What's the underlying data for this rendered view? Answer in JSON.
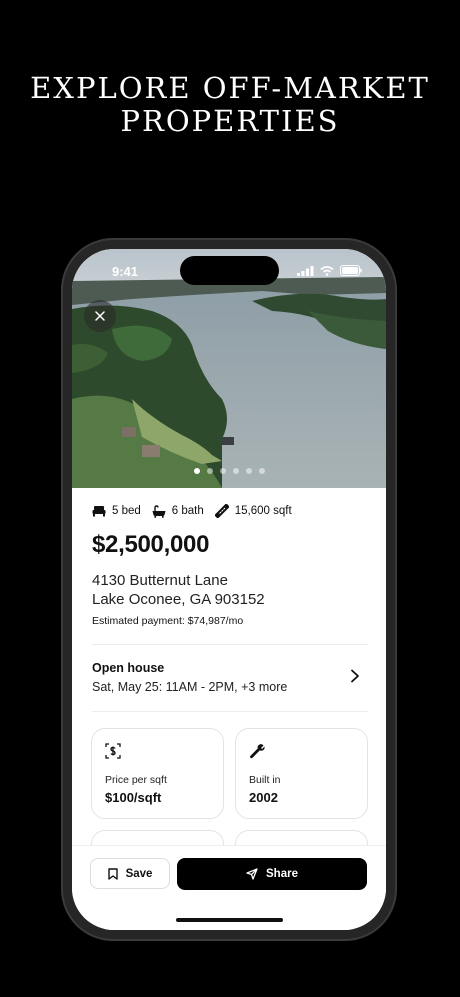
{
  "promo": {
    "headline_line1": "EXPLORE OFF-MARKET",
    "headline_line2": "PROPERTIES"
  },
  "status_bar": {
    "time": "9:41"
  },
  "photo": {
    "total_images": 6,
    "active_index": 0
  },
  "listing": {
    "beds": "5 bed",
    "baths": "6 bath",
    "sqft": "15,600 sqft",
    "price": "$2,500,000",
    "address_line1": "4130 Butternut Lane",
    "address_line2": "Lake Oconee, GA 903152",
    "estimated_payment": "Estimated payment: $74,987/mo"
  },
  "open_house": {
    "title": "Open house",
    "time": "Sat, May 25: 11AM - 2PM, +3 more"
  },
  "details": [
    {
      "icon": "dollar-tag-icon",
      "label": "Price per sqft",
      "value": "$100/sqft"
    },
    {
      "icon": "wrench-icon",
      "label": "Built in",
      "value": "2002"
    }
  ],
  "actions": {
    "save_label": "Save",
    "share_label": "Share"
  },
  "colors": {
    "background": "#000000",
    "accent": "#000000",
    "text": "#111111"
  }
}
